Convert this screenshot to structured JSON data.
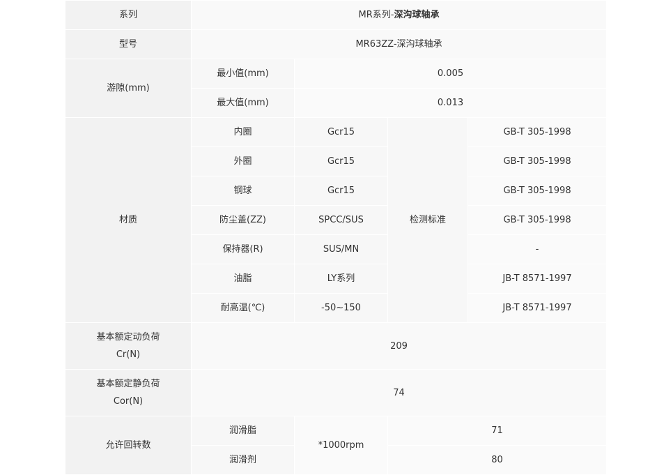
{
  "series": {
    "label": "系列",
    "value_prefix": "MR系列-",
    "value_bold": "深沟球轴承"
  },
  "model": {
    "label": "型号",
    "value": "MR63ZZ-深沟球轴承"
  },
  "clearance": {
    "label": "游隙(mm)",
    "min_label": "最小值(mm)",
    "min_value": "0.005",
    "max_label": "最大值(mm)",
    "max_value": "0.013"
  },
  "material": {
    "label": "材质",
    "standard_label": "检测标准",
    "rows": [
      {
        "part": "内圈",
        "material": "Gcr15",
        "standard": "GB-T 305-1998"
      },
      {
        "part": "外圈",
        "material": "Gcr15",
        "standard": "GB-T 305-1998"
      },
      {
        "part": "钢球",
        "material": "Gcr15",
        "standard": "GB-T 305-1998"
      },
      {
        "part": "防尘盖(ZZ)",
        "material": "SPCC/SUS",
        "standard": "GB-T 305-1998"
      },
      {
        "part": "保持器(R)",
        "material": "SUS/MN",
        "standard": "-"
      },
      {
        "part": "油脂",
        "material": "LY系列",
        "standard": "JB-T 8571-1997"
      },
      {
        "part": "耐高温(℃)",
        "material": "-50~150",
        "standard": "JB-T 8571-1997"
      }
    ]
  },
  "dynamic_load": {
    "label_line1": "基本额定动负荷",
    "label_line2": "Cr(N)",
    "value": "209"
  },
  "static_load": {
    "label_line1": "基本额定静负荷",
    "label_line2": "Cor(N)",
    "value": "74"
  },
  "speed": {
    "label": "允许回转数",
    "unit": "*1000rpm",
    "grease_label": "润滑脂",
    "grease_value": "71",
    "oil_label": "润滑剂",
    "oil_value": "80"
  }
}
